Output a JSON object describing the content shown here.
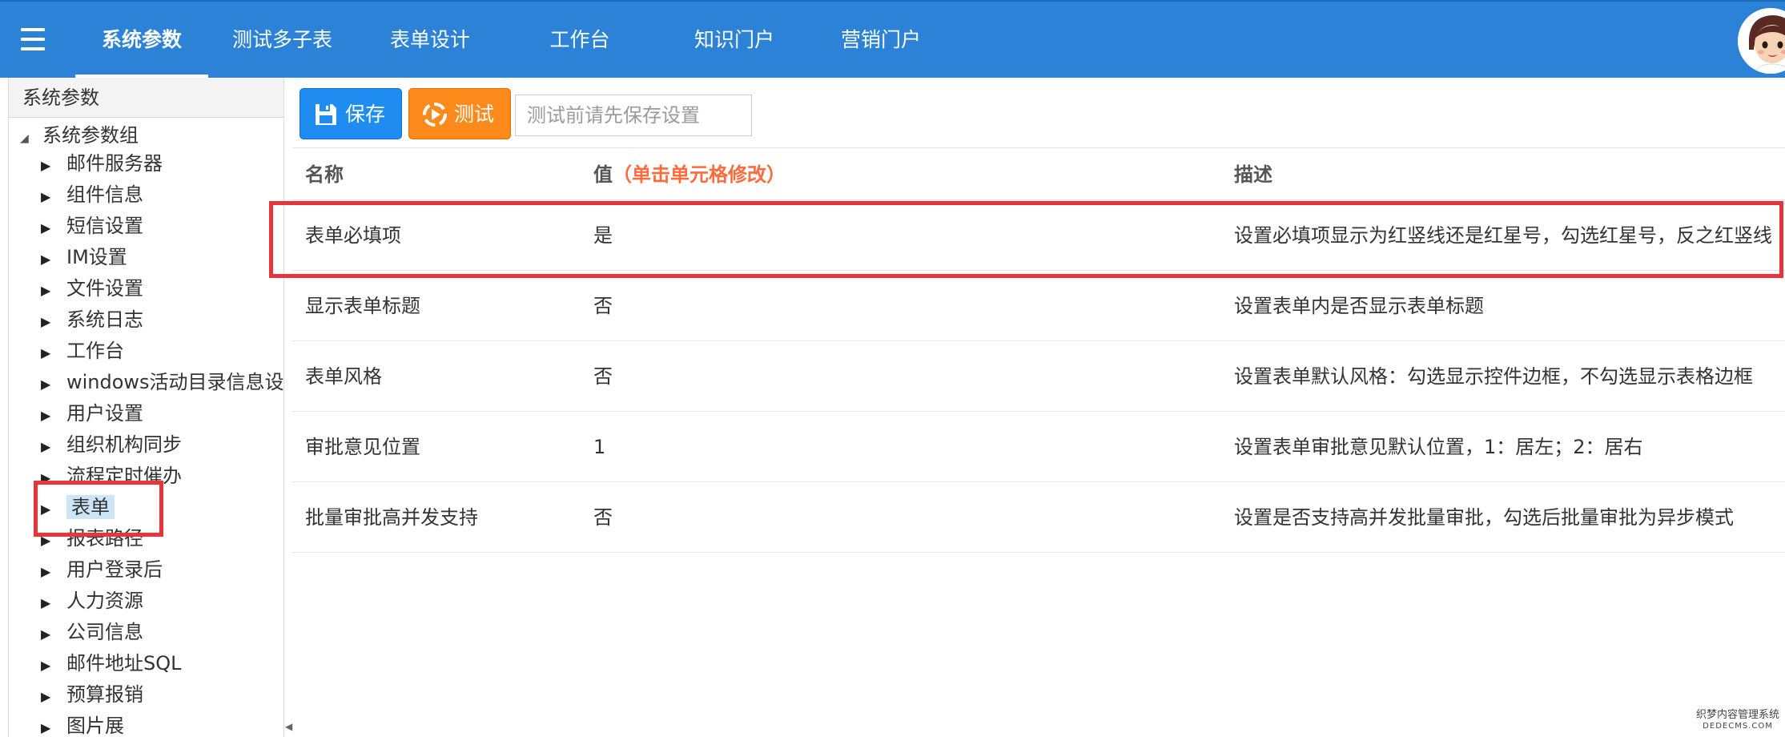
{
  "header": {
    "tabs": [
      {
        "label": "系统参数",
        "active": true
      },
      {
        "label": "测试多子表",
        "active": false
      },
      {
        "label": "表单设计",
        "active": false
      },
      {
        "label": "工作台",
        "active": false
      },
      {
        "label": "知识门户",
        "active": false
      },
      {
        "label": "营销门户",
        "active": false
      }
    ],
    "menu_icon": "menu-icon",
    "avatar_icon": "user-avatar-icon"
  },
  "sidebar": {
    "title": "系统参数",
    "root": "系统参数组",
    "items": [
      {
        "label": "邮件服务器"
      },
      {
        "label": "组件信息"
      },
      {
        "label": "短信设置"
      },
      {
        "label": "IM设置"
      },
      {
        "label": "文件设置"
      },
      {
        "label": "系统日志"
      },
      {
        "label": "工作台"
      },
      {
        "label": "windows活动目录信息设置"
      },
      {
        "label": "用户设置"
      },
      {
        "label": "组织机构同步"
      },
      {
        "label": "流程定时催办"
      },
      {
        "label": "表单",
        "selected": true
      },
      {
        "label": "报表路径"
      },
      {
        "label": "用户登录后"
      },
      {
        "label": "人力资源"
      },
      {
        "label": "公司信息"
      },
      {
        "label": "邮件地址SQL"
      },
      {
        "label": "预算报销"
      },
      {
        "label": "图片展"
      }
    ]
  },
  "toolbar": {
    "save_label": "保存",
    "test_label": "测试",
    "test_placeholder": "测试前请先保存设置",
    "save_icon": "floppy-disk-icon",
    "test_icon": "play-circle-icon"
  },
  "table": {
    "headers": {
      "name": "名称",
      "value": "值",
      "value_hint": "（单击单元格修改）",
      "desc": "描述"
    },
    "rows": [
      {
        "name": "表单必填项",
        "value": "是",
        "desc": "设置必填项显示为红竖线还是红星号，勾选红星号，反之红竖线"
      },
      {
        "name": "显示表单标题",
        "value": "否",
        "desc": "设置表单内是否显示表单标题"
      },
      {
        "name": "表单风格",
        "value": "否",
        "desc": "设置表单默认风格：勾选显示控件边框，不勾选显示表格边框"
      },
      {
        "name": "审批意见位置",
        "value": "1",
        "desc": "设置表单审批意见默认位置，1：居左；2：居右"
      },
      {
        "name": "批量审批高并发支持",
        "value": "否",
        "desc": "设置是否支持高并发批量审批，勾选后批量审批为异步模式"
      }
    ]
  },
  "watermark": {
    "line1": "织梦内容管理系统",
    "line2": "DEDECMS.COM"
  },
  "colors": {
    "header_bg": "#2b82d6",
    "save_button": "#1e8cf0",
    "test_button": "#ff8a1c",
    "highlight": "#e8343a",
    "hint": "#ff6b3d",
    "selected_bg": "#cde6f7"
  }
}
